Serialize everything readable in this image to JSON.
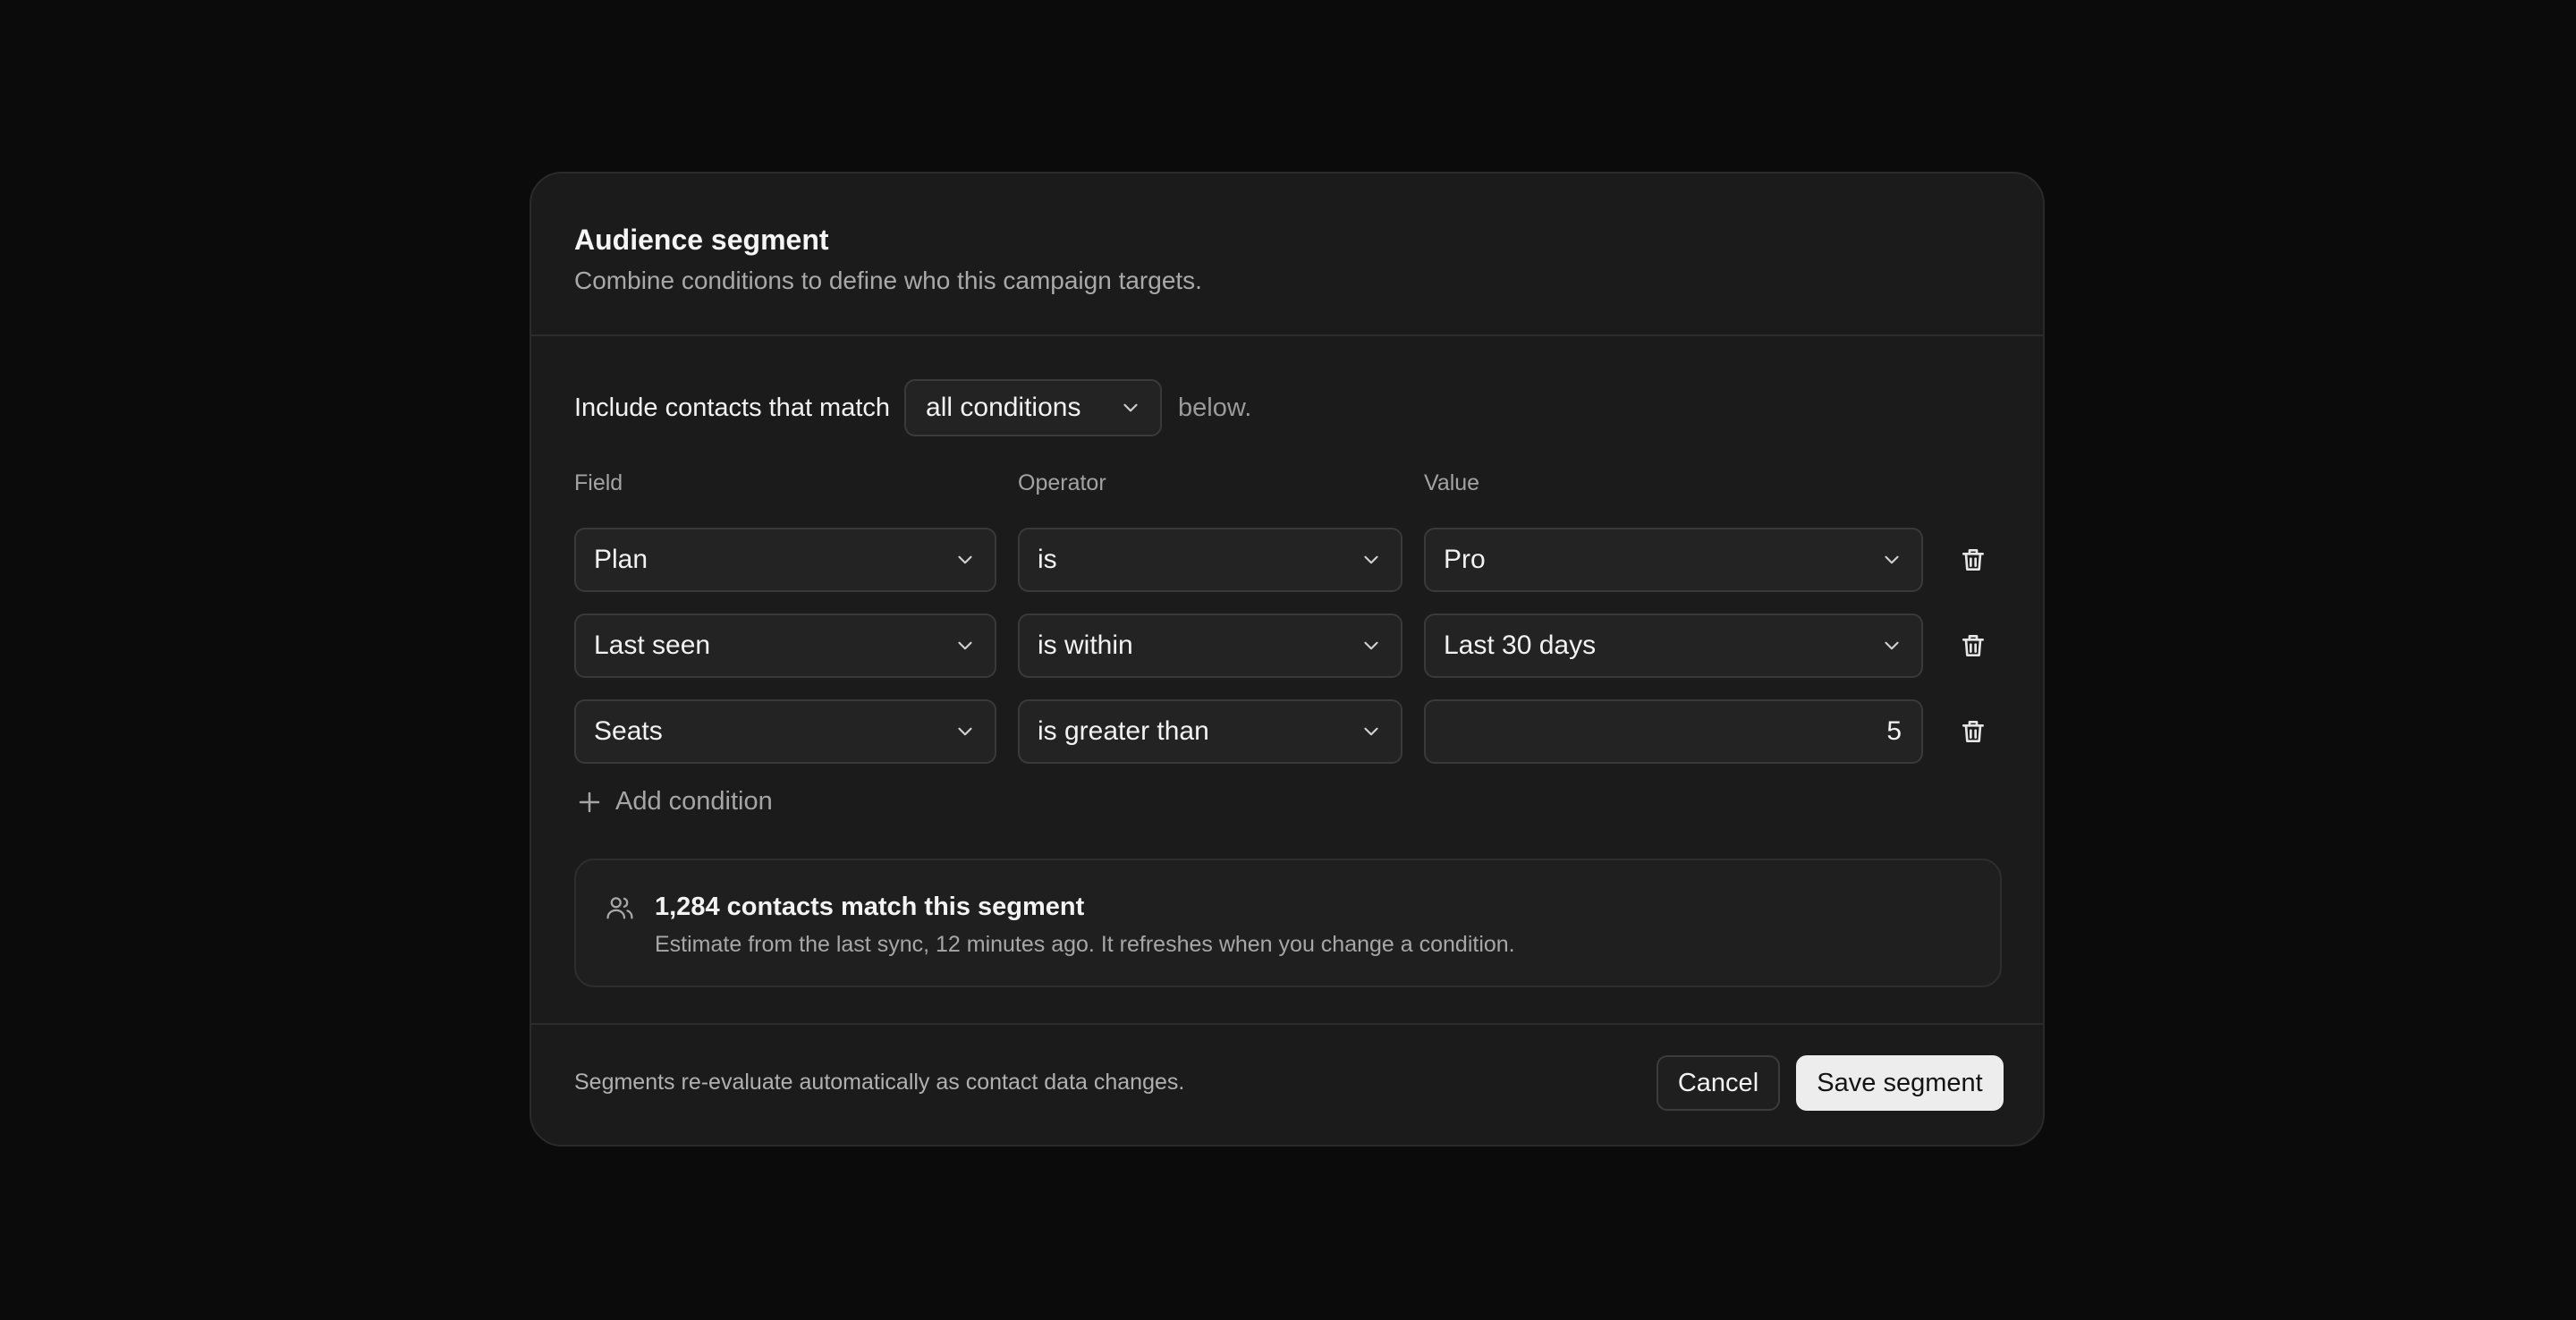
{
  "dialog": {
    "title": "Audience segment",
    "subtitle": "Combine conditions to define who this campaign targets."
  },
  "match": {
    "prefix": "Include contacts that match",
    "selected": "all conditions",
    "suffix": "below."
  },
  "columns": {
    "field": "Field",
    "operator": "Operator",
    "value": "Value"
  },
  "conditions": [
    {
      "field": "Plan",
      "operator": "is",
      "value": "Pro",
      "value_type": "select"
    },
    {
      "field": "Last seen",
      "operator": "is within",
      "value": "Last 30 days",
      "value_type": "select"
    },
    {
      "field": "Seats",
      "operator": "is greater than",
      "value": "5",
      "value_type": "number"
    }
  ],
  "add_condition_label": "Add condition",
  "estimate": {
    "icon": "users-icon",
    "title": "1,284 contacts match this segment",
    "subtitle": "Estimate from the last sync, 12 minutes ago. It refreshes when you change a condition."
  },
  "footer": {
    "note": "Segments re-evaluate automatically as contact data changes.",
    "cancel_label": "Cancel",
    "save_label": "Save segment"
  },
  "colors": {
    "background": "#0b0b0b",
    "surface": "#1b1b1b",
    "primary_button": "#ededed"
  }
}
